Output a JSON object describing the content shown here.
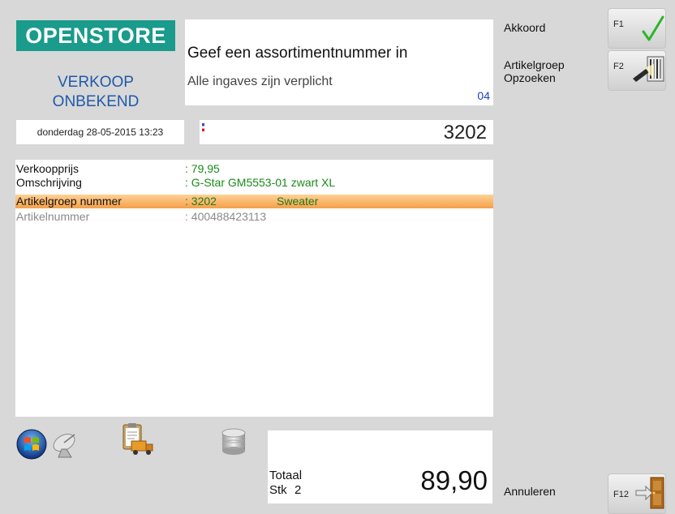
{
  "brand": {
    "logo": "OPENSTORE",
    "logo_color": "#1a9b8c"
  },
  "mode": {
    "line1": "VERKOOP",
    "line2": "ONBEKEND"
  },
  "prompt": {
    "message": "Geef een assortimentnummer in",
    "hint": "Alle ingaves zijn verplicht",
    "code": "04"
  },
  "datetime": "donderdag 28-05-2015 13:23",
  "input": {
    "value": "3202"
  },
  "details": {
    "rows": [
      {
        "label": "Verkoopprijs",
        "value": ": 79,95",
        "extra": ""
      },
      {
        "label": "Omschrijving",
        "value": ": G-Star GM5553-01 zwart XL",
        "extra": ""
      },
      {
        "label": "Artikelgroep nummer",
        "value": ": 3202",
        "extra": "Sweater"
      },
      {
        "label": "Artikelnummer",
        "value": ": 400488423113",
        "extra": ""
      }
    ]
  },
  "totals": {
    "label": "Totaal",
    "stk_label": "Stk",
    "stk_value": "2",
    "amount": "89,90"
  },
  "actions": {
    "akkoord": {
      "label": "Akkoord",
      "key": "F1"
    },
    "artikelgroep": {
      "label_line1": "Artikelgroep",
      "label_line2": "Opzoeken",
      "key": "F2"
    },
    "annuleren": {
      "label": "Annuleren",
      "key": "F12"
    }
  },
  "taskbar_icons": [
    "windows-start-icon",
    "satellite-dish-icon",
    "clipboard-truck-icon",
    "database-icon"
  ]
}
